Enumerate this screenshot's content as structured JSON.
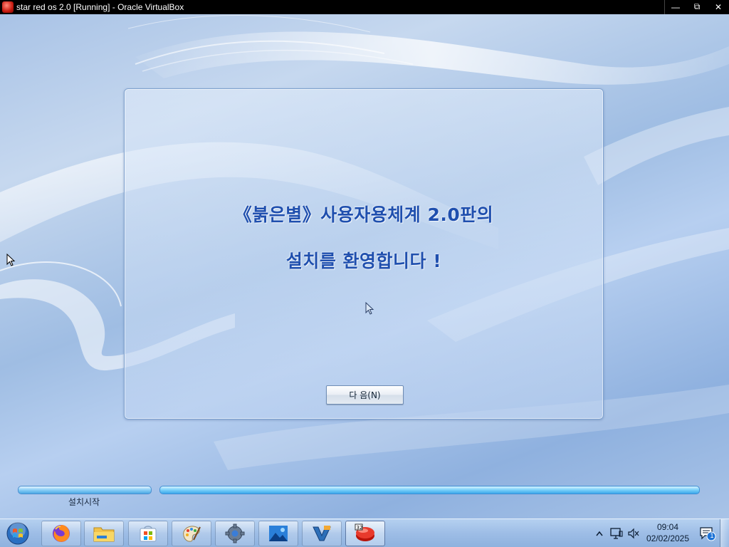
{
  "window": {
    "title": "star red os 2.0 [Running] - Oracle VirtualBox",
    "controls": {
      "minimize": "—",
      "restore": "⧉",
      "close": "✕"
    }
  },
  "installer": {
    "welcome_line1": "《붉은별》사용자용체계 2.0판의",
    "welcome_line2": "설치를 환영합니다 !",
    "next_button": "다 음(N)"
  },
  "progress": {
    "step_label": "설치시작"
  },
  "taskbar": {
    "apps": [
      {
        "icon": "firefox-icon"
      },
      {
        "icon": "file-explorer-icon"
      },
      {
        "icon": "microsoft-store-icon"
      },
      {
        "icon": "paint-icon"
      },
      {
        "icon": "settings-gear-icon"
      },
      {
        "icon": "photos-icon"
      },
      {
        "icon": "visual-studio-icon"
      },
      {
        "icon": "virtualbox-guest-icon"
      }
    ],
    "clock": {
      "time": "09:04",
      "date": "02/02/2025"
    },
    "notification_count": "1"
  },
  "colors": {
    "title_text": "#1f4fae",
    "progress_fill": "#4aa8e4",
    "taskbar": "#9dbde6"
  }
}
